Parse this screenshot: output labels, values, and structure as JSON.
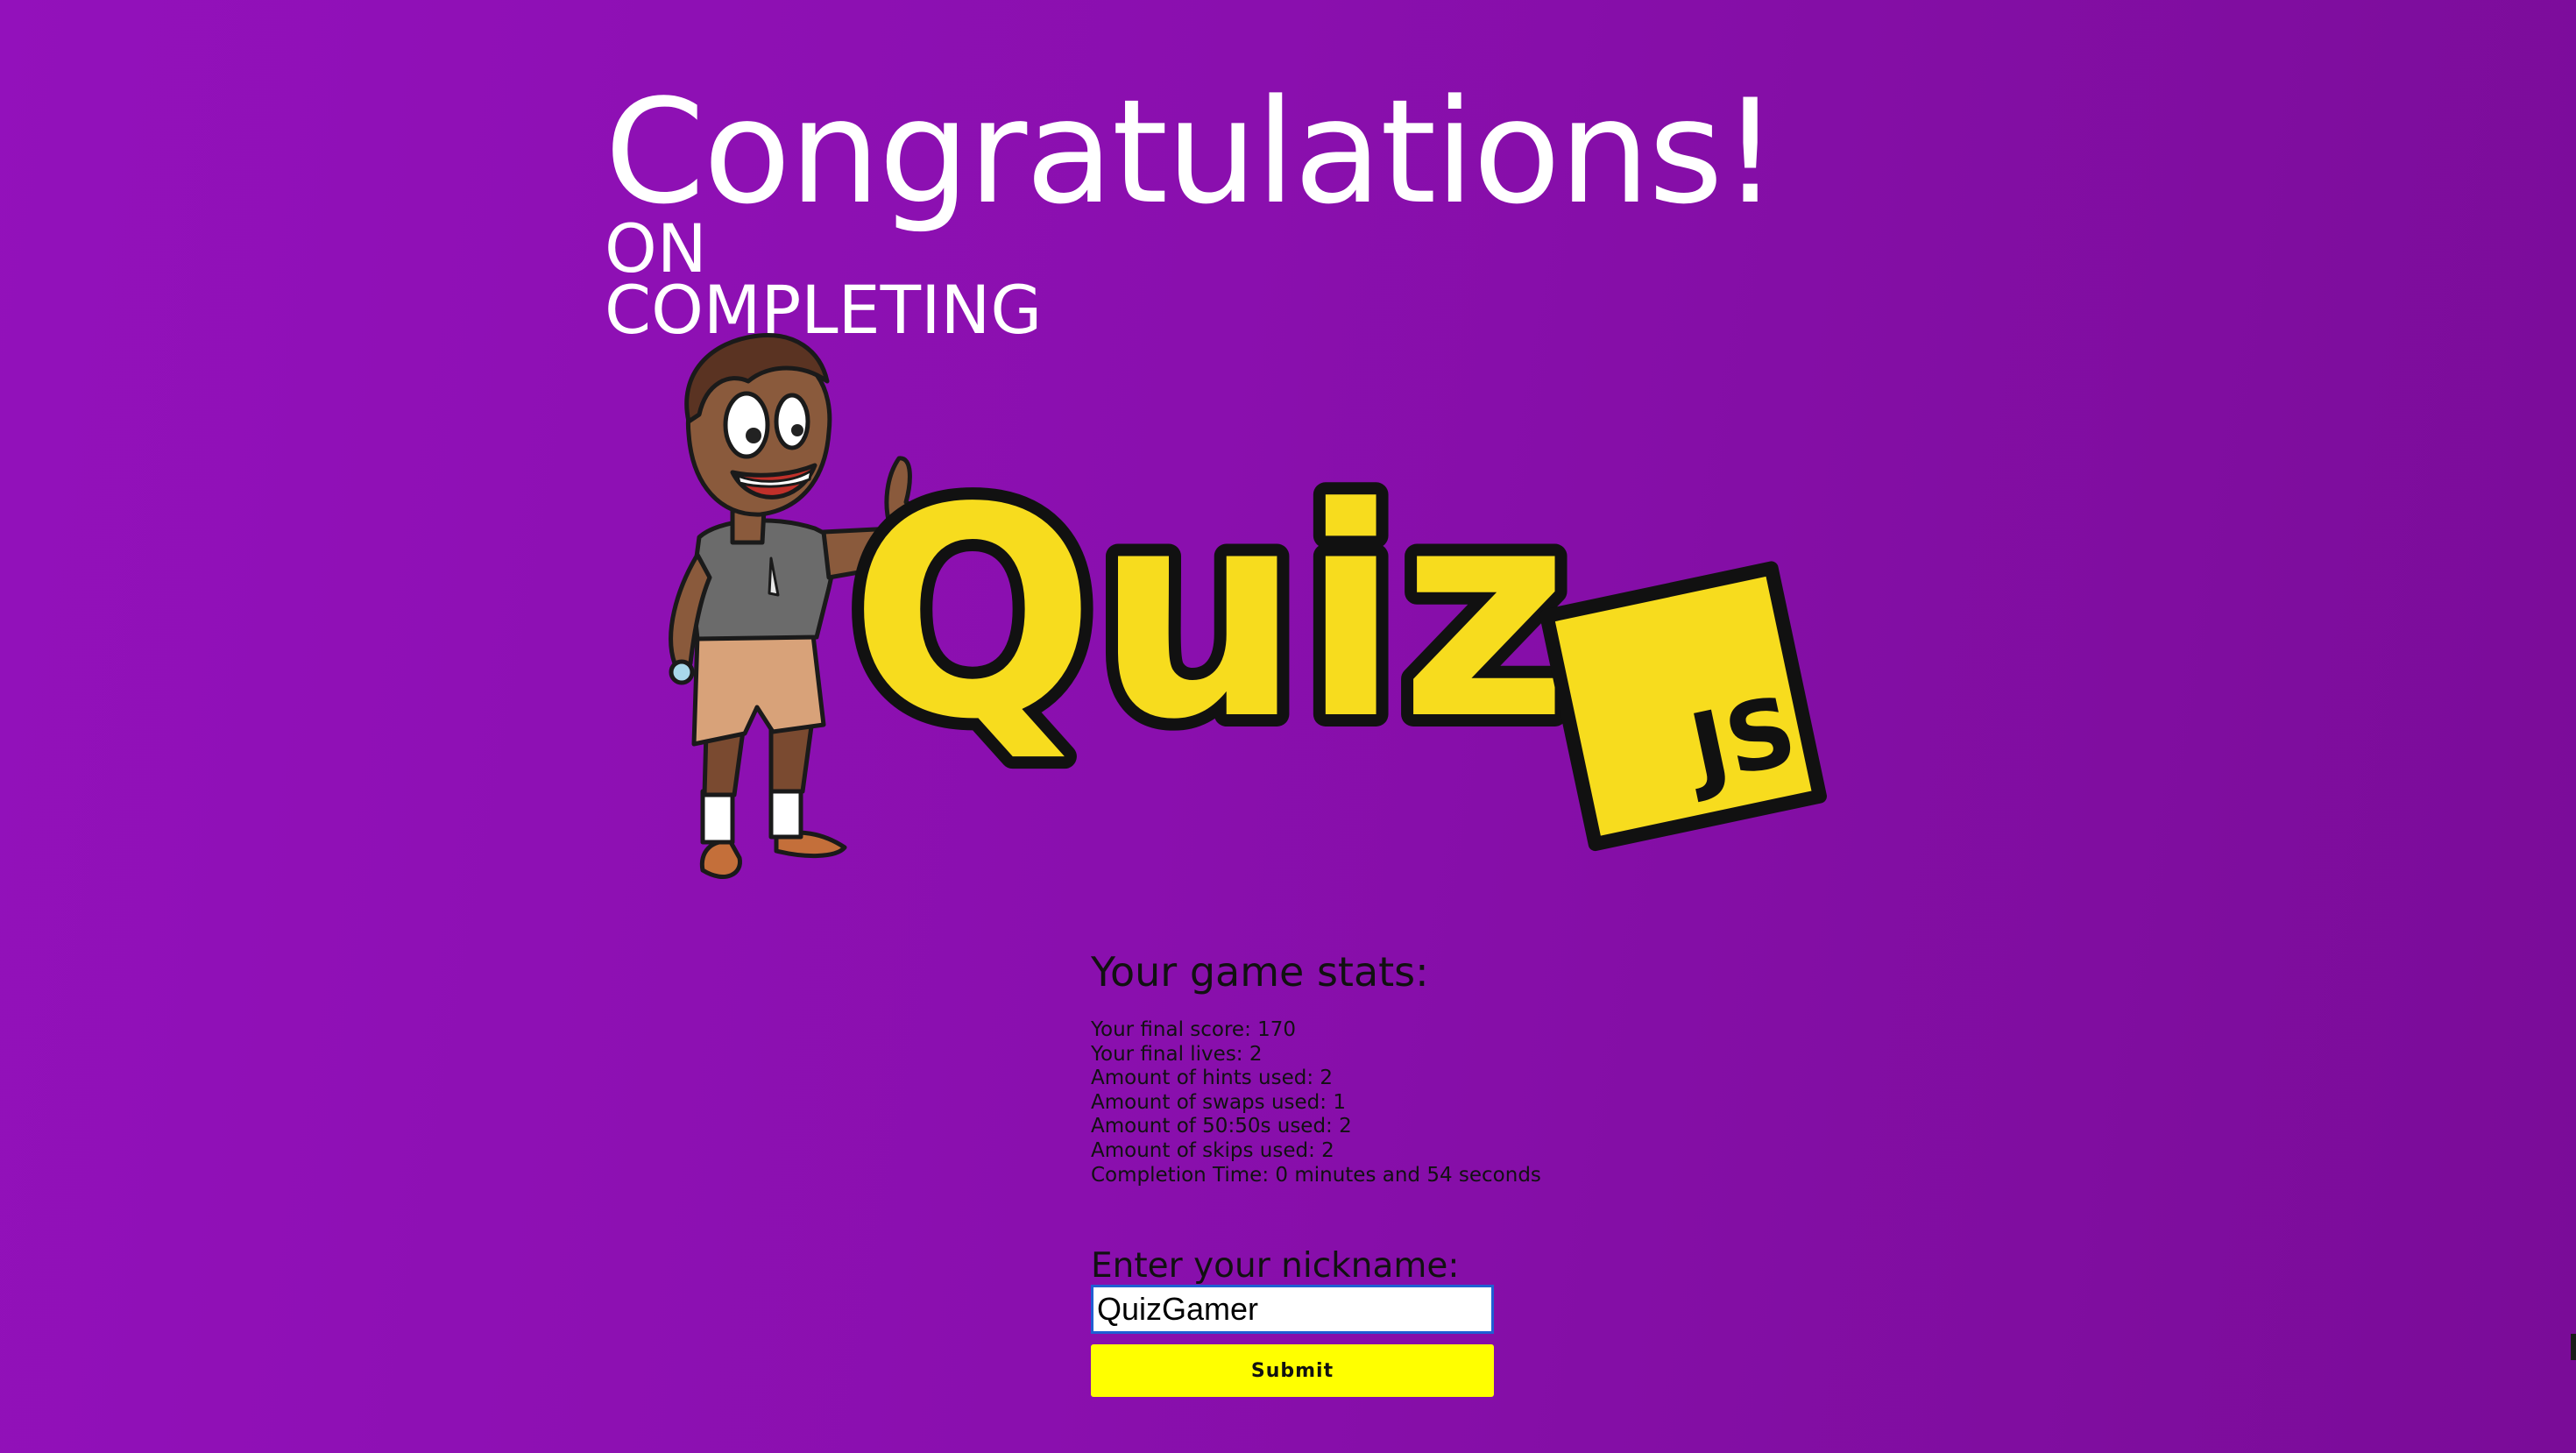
{
  "header": {
    "title": "Congratulations!",
    "subtitle_line1": "ON",
    "subtitle_line2": "COMPLETING"
  },
  "logo": {
    "main_text": "Quiz",
    "badge_text": "JS",
    "mascot_icon": "thumbs-up-boy-mascot",
    "colors": {
      "logo_yellow": "#f7dc1e",
      "outline": "#111111"
    }
  },
  "stats": {
    "heading": "Your game stats:",
    "rows": [
      "Your final score: 170",
      "Your final lives: 2",
      "Amount of hints used: 2",
      "Amount of swaps used: 1",
      "Amount of 50:50s used: 2",
      "Amount of skips used: 2",
      "Completion Time: 0 minutes and 54 seconds"
    ]
  },
  "form": {
    "label": "Enter your nickname:",
    "nickname_value": "QuizGamer",
    "submit_label": "Submit"
  },
  "theme": {
    "background_start": "#9311bb",
    "background_end": "#7a0c98",
    "button_color": "#ffff00",
    "input_border": "#1f5fd3"
  }
}
